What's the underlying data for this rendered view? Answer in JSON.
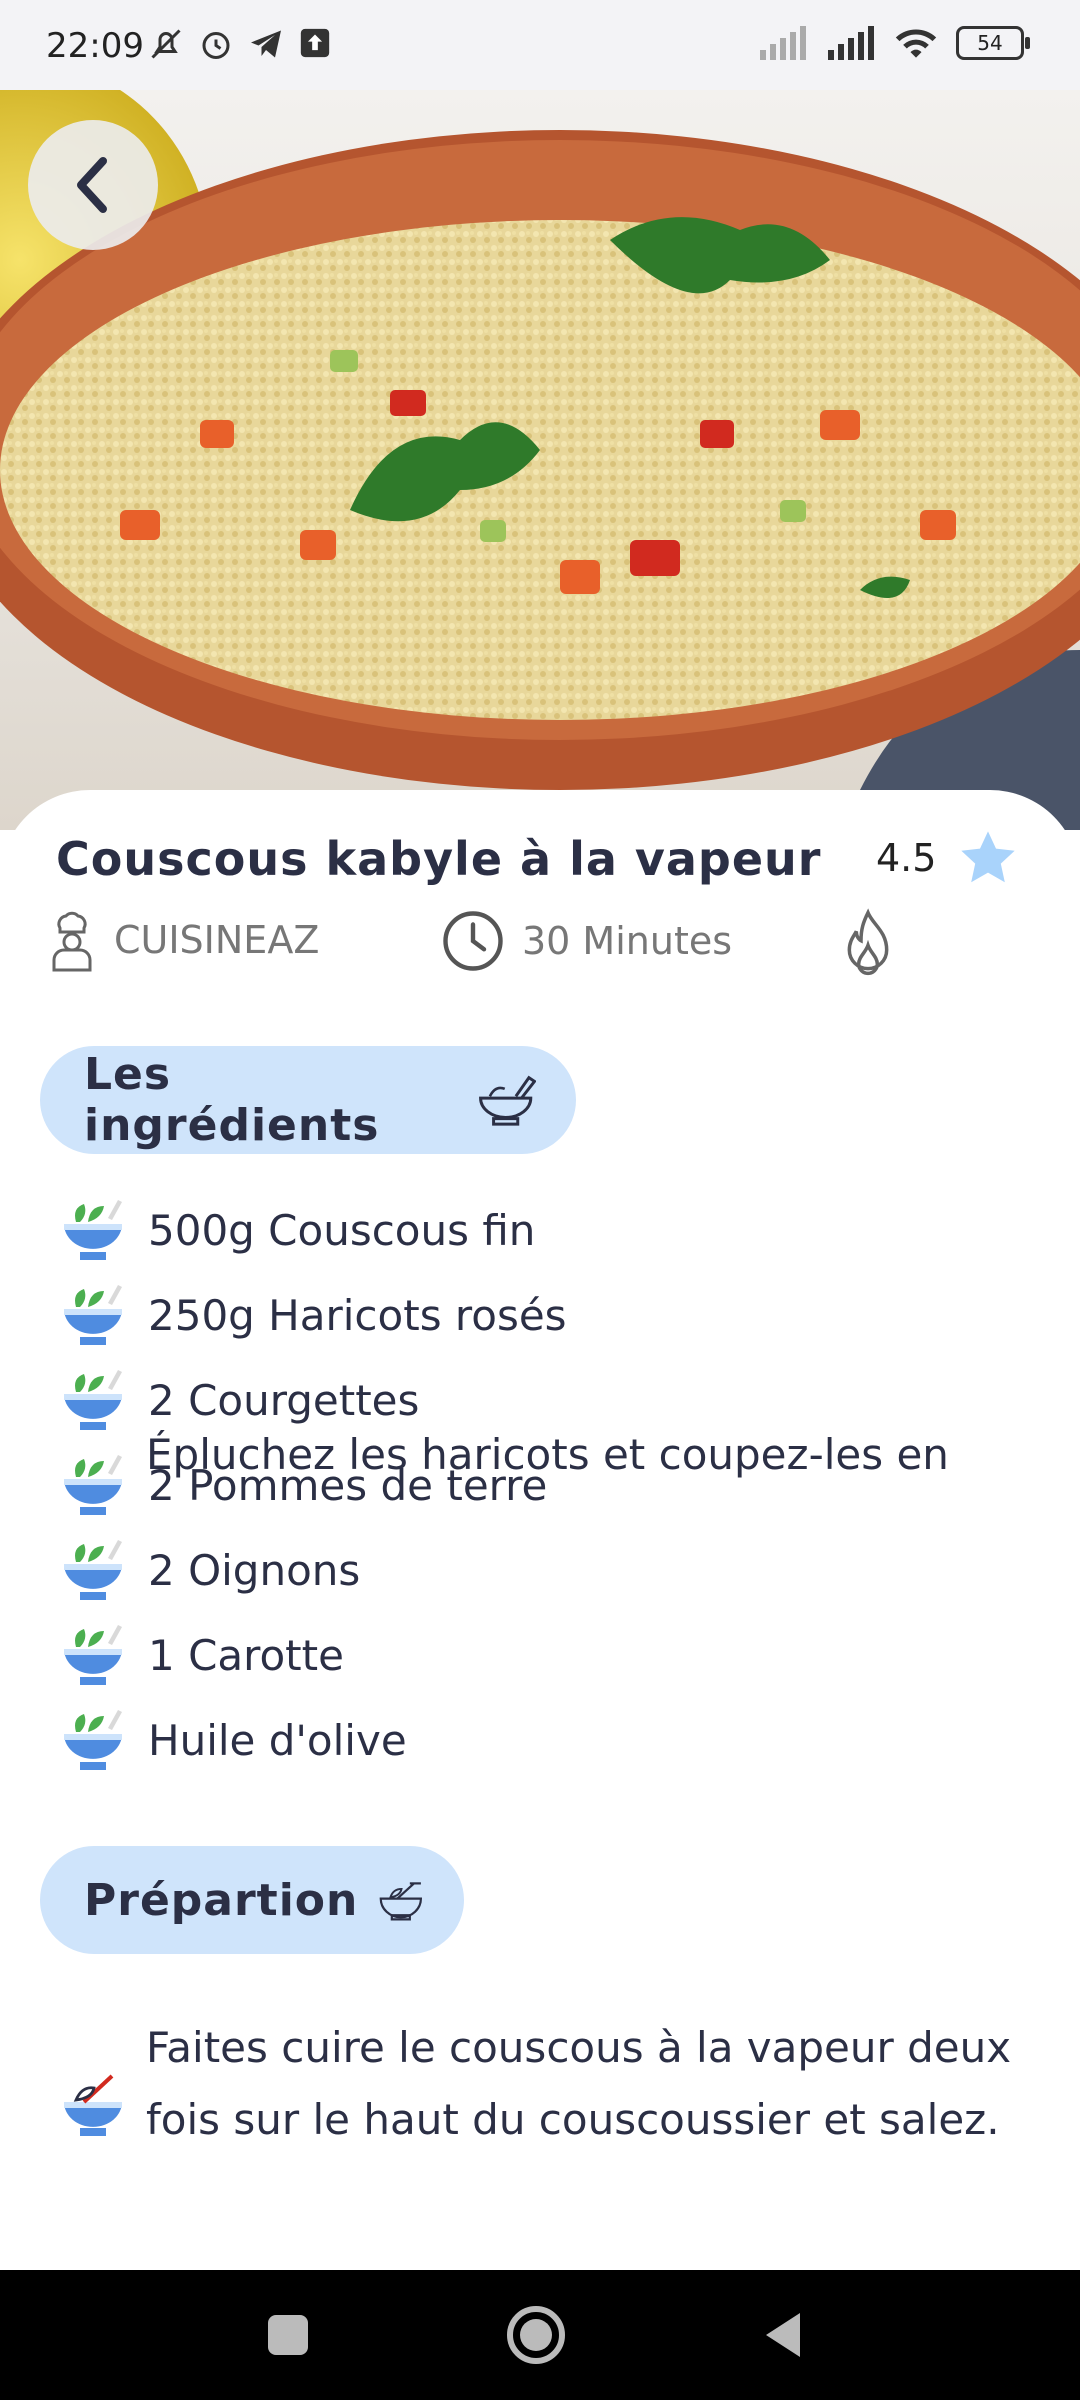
{
  "status_bar": {
    "time": "22:09",
    "battery": "54",
    "icons": [
      "mute-icon",
      "alarm-icon",
      "telegram-icon",
      "upload-icon",
      "signal-icon",
      "signal-icon",
      "wifi-icon"
    ]
  },
  "hero": {
    "image": "couscous-dish-photo"
  },
  "recipe": {
    "title": "Couscous kabyle à la vapeur",
    "rating": "4.5",
    "author": "CUISINEAZ",
    "duration": "30 Minutes"
  },
  "ingredients_section": {
    "label": "Les ingrédients",
    "items": [
      "500g Couscous fin",
      "250g Haricots rosés",
      "2 Courgettes",
      "2 Pommes de terre",
      "2 Oignons",
      "1 Carotte",
      "Huile d'olive"
    ]
  },
  "preparation_section": {
    "label": "Prépartion",
    "steps": [
      "Faites cuire le couscous à la vapeur deux fois sur le haut du couscoussier et salez.",
      "Épluchez les haricots et coupez-les en"
    ]
  },
  "colors": {
    "accent": "#cfe4fb",
    "star": "#a9d3fb",
    "text": "#2b2f45"
  }
}
